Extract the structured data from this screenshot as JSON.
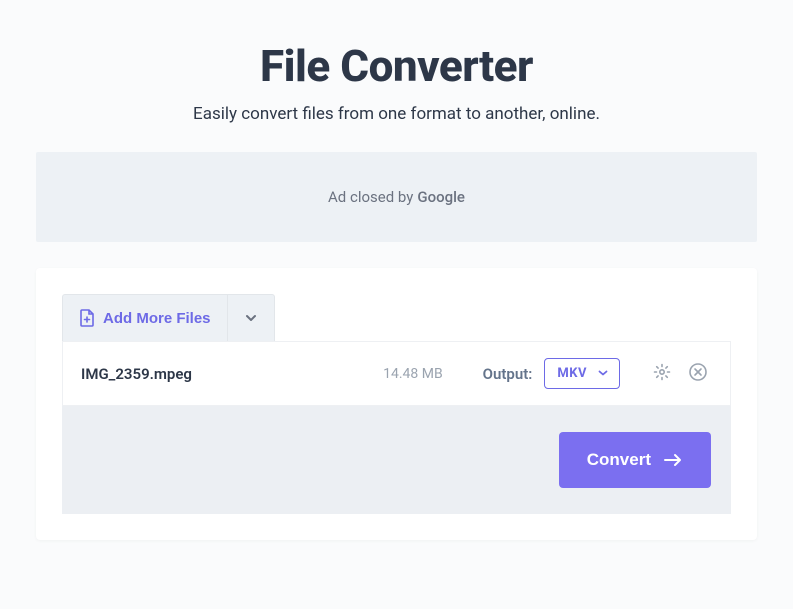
{
  "header": {
    "title": "File Converter",
    "subtitle": "Easily convert files from one format to another, online."
  },
  "ad": {
    "text": "Ad closed by",
    "brand": "Google"
  },
  "toolbar": {
    "add_more_label": "Add More Files"
  },
  "file": {
    "name": "IMG_2359.mpeg",
    "size": "14.48 MB",
    "output_label": "Output:",
    "format": "MKV"
  },
  "actions": {
    "convert_label": "Convert"
  },
  "colors": {
    "accent": "#7b6ff0",
    "text_dark": "#2d3748",
    "muted": "#9aa3af"
  }
}
